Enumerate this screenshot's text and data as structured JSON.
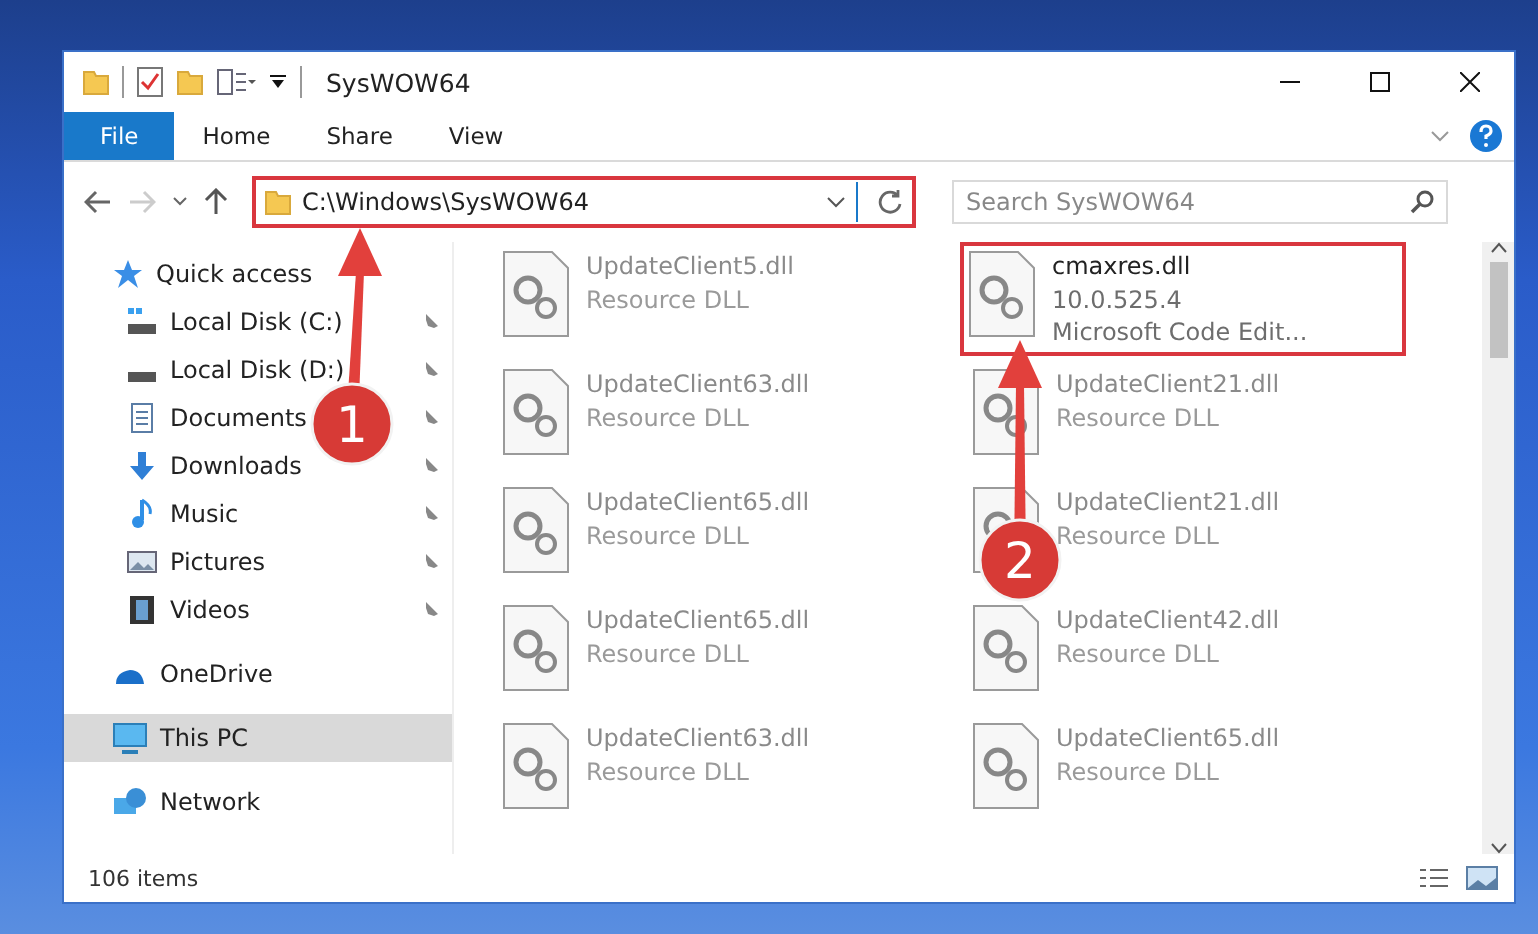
{
  "window": {
    "title": "SysWOW64"
  },
  "ribbon_tabs": [
    {
      "label": "File",
      "selected": true
    },
    {
      "label": "Home",
      "selected": false
    },
    {
      "label": "Share",
      "selected": false
    },
    {
      "label": "View",
      "selected": false
    }
  ],
  "address_bar": {
    "path": "C:\\Windows\\SysWOW64",
    "highlighted": true
  },
  "search": {
    "placeholder": "Search SysWOW64"
  },
  "sidebar": {
    "items": [
      {
        "kind": "star",
        "label": "Quick access",
        "pinned": false,
        "selected": false,
        "group": true
      },
      {
        "kind": "drive",
        "label": "Local Disk (C:)",
        "pinned": true,
        "selected": false,
        "group": false
      },
      {
        "kind": "disk",
        "label": "Local Disk (D:)",
        "pinned": true,
        "selected": false,
        "group": false
      },
      {
        "kind": "document",
        "label": "Documents",
        "pinned": true,
        "selected": false,
        "group": false
      },
      {
        "kind": "download",
        "label": "Downloads",
        "pinned": true,
        "selected": false,
        "group": false
      },
      {
        "kind": "music",
        "label": "Music",
        "pinned": true,
        "selected": false,
        "group": false
      },
      {
        "kind": "picture",
        "label": "Pictures",
        "pinned": true,
        "selected": false,
        "group": false
      },
      {
        "kind": "video",
        "label": "Videos",
        "pinned": true,
        "selected": false,
        "group": false
      },
      {
        "kind": "cloud",
        "label": "OneDrive",
        "pinned": false,
        "selected": false,
        "group": true
      },
      {
        "kind": "computer",
        "label": "This PC",
        "pinned": false,
        "selected": true,
        "group": true
      },
      {
        "kind": "network",
        "label": "Network",
        "pinned": false,
        "selected": false,
        "group": true
      }
    ]
  },
  "files": [
    {
      "name": "UpdateClient5.dll",
      "details": [
        "Resource DLL"
      ],
      "faded": true,
      "highlighted": false
    },
    {
      "name": "cmaxres.dll",
      "details": [
        "10.0.525.4",
        "Microsoft Code Edit..."
      ],
      "faded": false,
      "highlighted": true
    },
    {
      "name": "UpdateClient63.dll",
      "details": [
        "Resource DLL"
      ],
      "faded": true,
      "highlighted": false
    },
    {
      "name": "UpdateClient21.dll",
      "details": [
        "Resource DLL"
      ],
      "faded": true,
      "highlighted": false
    },
    {
      "name": "UpdateClient65.dll",
      "details": [
        "Resource DLL"
      ],
      "faded": true,
      "highlighted": false
    },
    {
      "name": "UpdateClient21.dll",
      "details": [
        "Resource DLL"
      ],
      "faded": true,
      "highlighted": false
    },
    {
      "name": "UpdateClient65.dll",
      "details": [
        "Resource DLL"
      ],
      "faded": true,
      "highlighted": false
    },
    {
      "name": "UpdateClient42.dll",
      "details": [
        "Resource DLL"
      ],
      "faded": true,
      "highlighted": false
    },
    {
      "name": "UpdateClient63.dll",
      "details": [
        "Resource DLL"
      ],
      "faded": true,
      "highlighted": false
    },
    {
      "name": "UpdateClient65.dll",
      "details": [
        "Resource DLL"
      ],
      "faded": true,
      "highlighted": false
    }
  ],
  "status_bar": {
    "item_count": "106 items"
  },
  "callouts": [
    {
      "label": "1"
    },
    {
      "label": "2"
    }
  ]
}
